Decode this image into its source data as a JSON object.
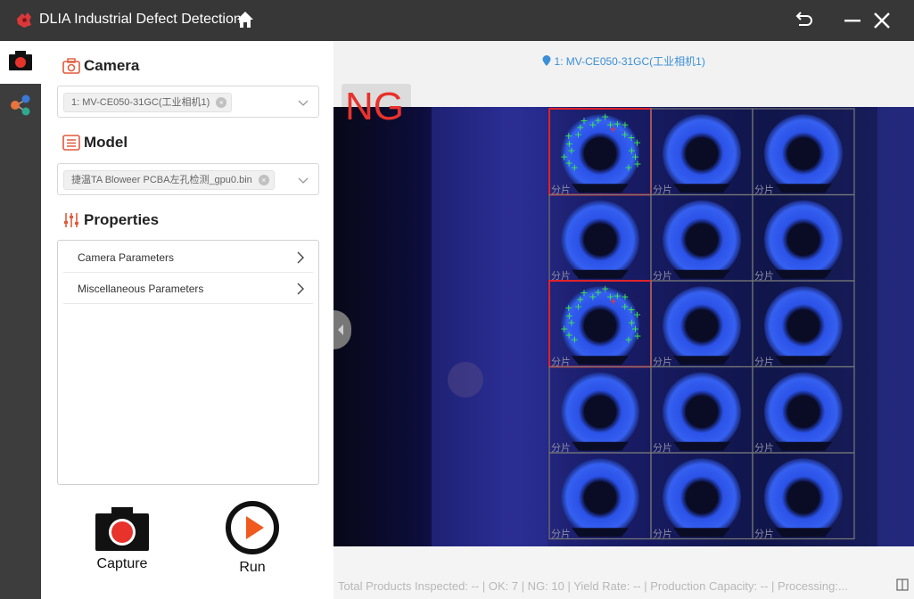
{
  "app": {
    "title": "DLIA Industrial Defect Detection",
    "accent": "#e8322c",
    "link_color": "#3a8fd6"
  },
  "titlebar": {
    "icons": [
      "app-logo-icon",
      "home-icon",
      "back-icon",
      "minimize-icon",
      "close-icon"
    ]
  },
  "rail": {
    "items": [
      {
        "icon": "camera-icon",
        "active": true
      },
      {
        "icon": "model-nodes-icon",
        "active": false
      }
    ]
  },
  "camera": {
    "heading": "Camera",
    "selected": "1: MV-CE050-31GC(工业相机1)"
  },
  "model": {
    "heading": "Model",
    "selected": "捷温TA Bloweer PCBA左孔检测_gpu0.bin"
  },
  "properties": {
    "heading": "Properties",
    "items": [
      "Camera Parameters",
      "Miscellaneous Parameters"
    ]
  },
  "actions": {
    "capture_label": "Capture",
    "run_label": "Run"
  },
  "viewer": {
    "camera_label": "1: MV-CE050-31GC(工业相机1)",
    "result": "NG",
    "grid_rows": 5,
    "grid_cols": 3,
    "tile_label": "分片",
    "defect_tiles": [
      [
        0,
        0
      ],
      [
        2,
        0
      ]
    ]
  },
  "stats": {
    "text": "Total Products Inspected: -- | OK: 7 | NG: 10 | Yield Rate: -- | Production Capacity: -- | Processing:..."
  }
}
